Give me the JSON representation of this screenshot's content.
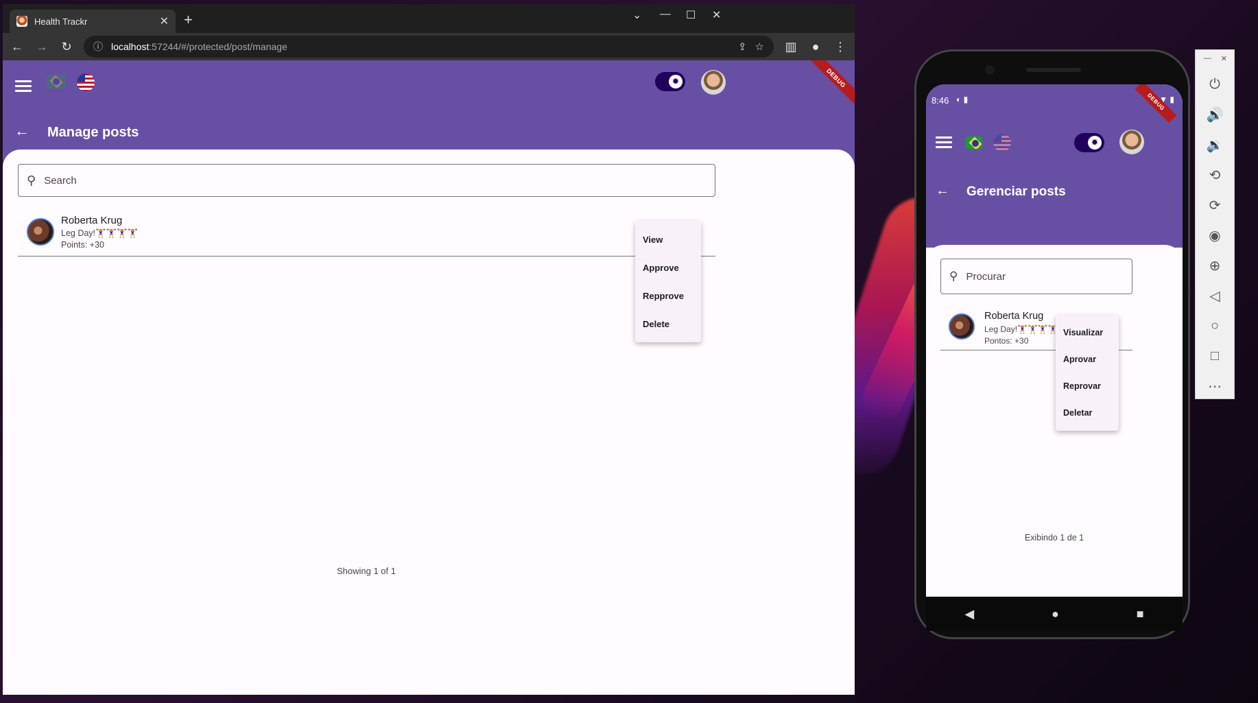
{
  "browser": {
    "tab_title": "Health Trackr",
    "tab_close": "✕",
    "new_tab": "+",
    "url_host": "localhost",
    "url_rest": ":57244/#/protected/post/manage"
  },
  "web_app": {
    "page_title": "Manage posts",
    "search_placeholder": "Search",
    "post": {
      "author": "Roberta Krug",
      "description": "Leg Day!🏋️‍♀️🏋️‍♀️🏋️‍♀️🏋️‍♀️",
      "points": "Points: +30"
    },
    "menu": [
      "View",
      "Approve",
      "Repprove",
      "Delete"
    ],
    "footer": "Showing 1 of 1",
    "debug_label": "DEBUG"
  },
  "mobile_app": {
    "status_time": "8:46",
    "page_title": "Gerenciar posts",
    "search_placeholder": "Procurar",
    "post": {
      "author": "Roberta Krug",
      "description": "Leg Day!🏋️‍♀️🏋️‍♀️🏋️‍♀️🏋️‍♀️",
      "points": "Pontos: +30"
    },
    "menu": [
      "Visualizar",
      "Aprovar",
      "Reprovar",
      "Deletar"
    ],
    "footer": "Exibindo 1 de 1",
    "debug_label": "DEBUG"
  },
  "colors": {
    "primary": "#6750a4",
    "surface": "#fffbfe",
    "toggle_track": "#21005d",
    "debug_ribbon": "#b71c1c"
  }
}
